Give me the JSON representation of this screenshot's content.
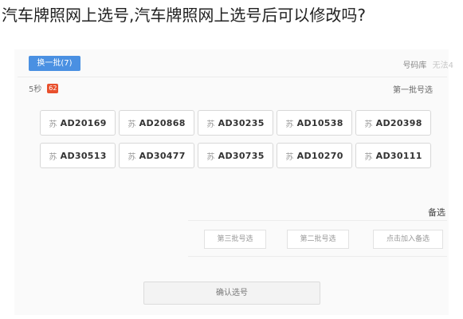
{
  "headline": "汽车牌照网上选号,汽车牌照网上选号后可以修改吗?",
  "toolbar": {
    "change_button": "换一批(7)",
    "right_label": "号码库",
    "right_faint": "无法4"
  },
  "subbar": {
    "left_label": "5秒",
    "badge_text": "62",
    "right_label": "第一批号选"
  },
  "plates": [
    {
      "prov": "苏",
      "number": "AD20169"
    },
    {
      "prov": "苏",
      "number": "AD20868"
    },
    {
      "prov": "苏",
      "number": "AD30235"
    },
    {
      "prov": "苏",
      "number": "AD10538"
    },
    {
      "prov": "苏",
      "number": "AD20398"
    },
    {
      "prov": "苏",
      "number": "AD30513"
    },
    {
      "prov": "苏",
      "number": "AD30477"
    },
    {
      "prov": "苏",
      "number": "AD30735"
    },
    {
      "prov": "苏",
      "number": "AD10270"
    },
    {
      "prov": "苏",
      "number": "AD30111"
    }
  ],
  "alternates": {
    "label": "备选",
    "buttons": [
      "第三批号选",
      "第二批号选",
      "点击加入备选"
    ]
  },
  "confirm_button": "确认选号",
  "colors": {
    "accent": "#4a90e2",
    "badge": "#e8502d"
  }
}
